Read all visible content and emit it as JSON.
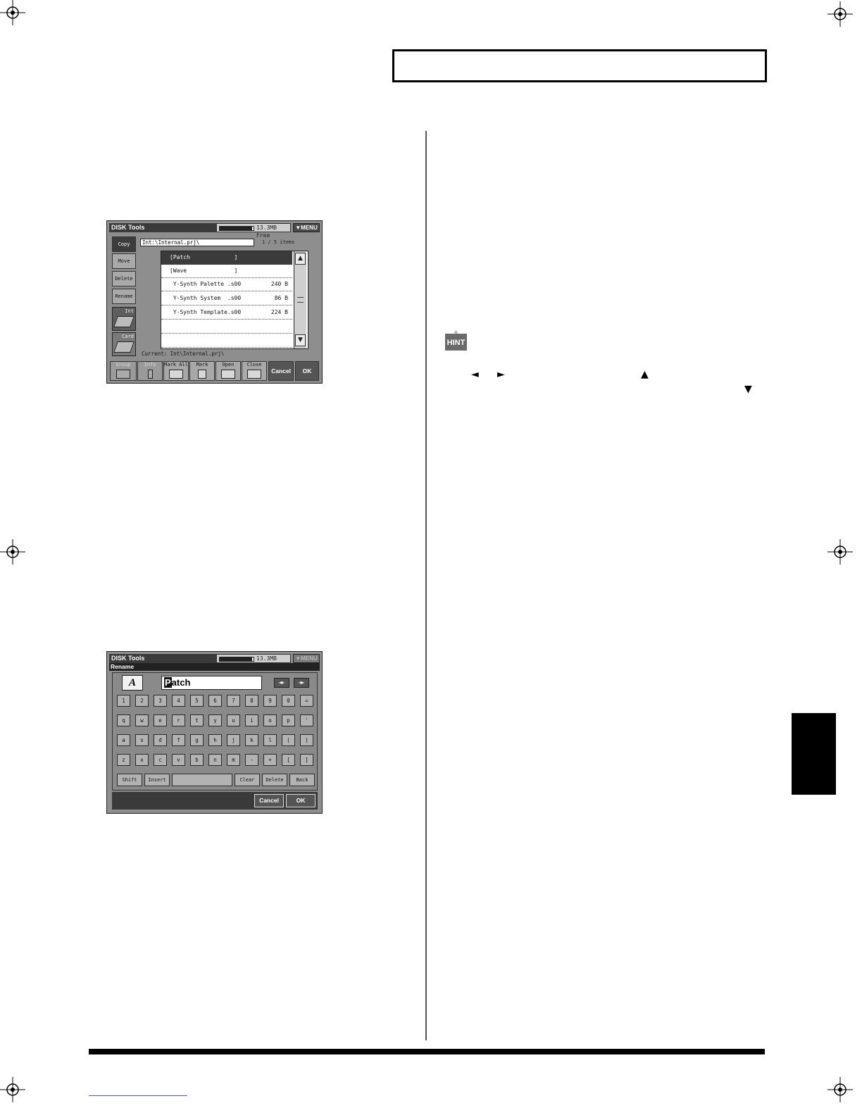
{
  "page": {
    "hint_label": "HINT",
    "hint_arrows": {
      "left": "◄",
      "right": "►",
      "up": "▲",
      "down": "▼"
    }
  },
  "screen1": {
    "title": "DISK Tools",
    "free_text": "13.3MB Free",
    "free_level": 0.95,
    "menu_label": "▼MENU",
    "side_buttons": [
      "Copy",
      "Move",
      "Delete",
      "Rename"
    ],
    "device_buttons": [
      "Int",
      "Card"
    ],
    "path": "Int:\\Internal.prj\\",
    "item_count": "1 / 5 items",
    "files": [
      {
        "name": "[Patch             ]",
        "size": ""
      },
      {
        "name": "[Wave              ]",
        "size": ""
      },
      {
        "name": " Y-Synth Palette .s00",
        "size": "240  B"
      },
      {
        "name": " Y-Synth System  .s00",
        "size": "86  B"
      },
      {
        "name": " Y-Synth Template.s00",
        "size": "224  B"
      }
    ],
    "current_label": "Current: Int\\Internal.prj\\",
    "function_buttons": [
      "Group",
      "Info",
      "Mark All",
      "Mark",
      "Open",
      "Close",
      "Cancel",
      "OK"
    ],
    "colors": {
      "selected_row": "#3b3b3b",
      "panel": "#8e8e8e"
    }
  },
  "screen2": {
    "title": "DISK Tools",
    "free_text": "13.3MB Free",
    "menu_label": "▼MENU",
    "subtitle": "Rename",
    "name_icon": "A",
    "name_cursor_char": "P",
    "name_rest": "atch",
    "arrow_left": "◄-",
    "arrow_right": "-►",
    "keys": [
      [
        "1",
        "2",
        "3",
        "4",
        "5",
        "6",
        "7",
        "8",
        "9",
        "0",
        "="
      ],
      [
        "q",
        "w",
        "e",
        "r",
        "t",
        "y",
        "u",
        "i",
        "o",
        "p",
        "'"
      ],
      [
        "a",
        "s",
        "d",
        "f",
        "g",
        "h",
        "j",
        "k",
        "l",
        "(",
        ")"
      ],
      [
        "z",
        "x",
        "c",
        "v",
        "b",
        "n",
        "m",
        "-",
        "+",
        "[",
        "]"
      ]
    ],
    "fn_keys": [
      "Shift",
      "Insert",
      "",
      "Clear",
      "Delete",
      "Back"
    ],
    "cancel_label": "Cancel",
    "ok_label": "OK"
  }
}
